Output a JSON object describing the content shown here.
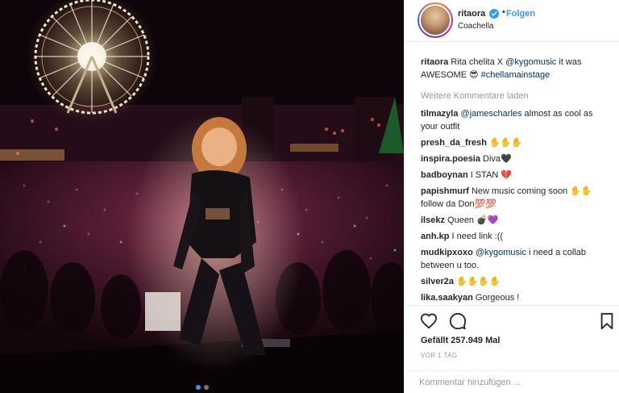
{
  "post": {
    "photo_alt": "Photo by ritaora at Coachella",
    "carousel_dots": 2,
    "active_dot": 0
  },
  "header": {
    "username": "ritaora",
    "separator": "•",
    "follow_label": "Folgen",
    "location": "Coachella",
    "verified_icon": "verified-badge-icon"
  },
  "caption": {
    "username": "ritaora",
    "text_before": " Rita chelita X ",
    "mention": "@kygomusic",
    "text_after": " it was AWESOME 😎 ",
    "hashtag": "#chellamainstage"
  },
  "load_more_label": "Weitere Kommentare laden",
  "comments": [
    {
      "username": "tilmazyla",
      "mention": "@jamescharles",
      "text": " almost as cool as your outfit"
    },
    {
      "username": "presh_da_fresh",
      "mention": "",
      "text": " ✋✋✋"
    },
    {
      "username": "inspira.poesia",
      "mention": "",
      "text": " Diva🖤"
    },
    {
      "username": "badboynan",
      "mention": "",
      "text": " I STAN 💔"
    },
    {
      "username": "papishmurf",
      "mention": "",
      "text": " New music coming soon ✋✋ follow da Don💯💯"
    },
    {
      "username": "ilsekz",
      "mention": "",
      "text": " Queen 💣💜"
    },
    {
      "username": "anh.kp",
      "mention": "",
      "text": " I need link :(("
    },
    {
      "username": "mudkipxoxo",
      "mention": "@kygomusic",
      "text": " i need a collab between u too."
    },
    {
      "username": "silver2a",
      "mention": "",
      "text": " ✋✋✋✋"
    },
    {
      "username": "lika.saakyan",
      "mention": "",
      "text": " Gorgeous !"
    }
  ],
  "actions": {
    "like_icon": "heart-icon",
    "comment_icon": "comment-bubble-icon",
    "save_icon": "bookmark-icon"
  },
  "likes_label": "Gefällt 257.949 Mal",
  "timestamp": "VOR 1 TAG",
  "comment_input": {
    "placeholder": "Kommentar hinzufügen ...",
    "value": ""
  },
  "colors": {
    "link_blue": "#3897f0",
    "mention_blue": "#003569",
    "muted_gray": "#999999",
    "text": "#262626"
  }
}
